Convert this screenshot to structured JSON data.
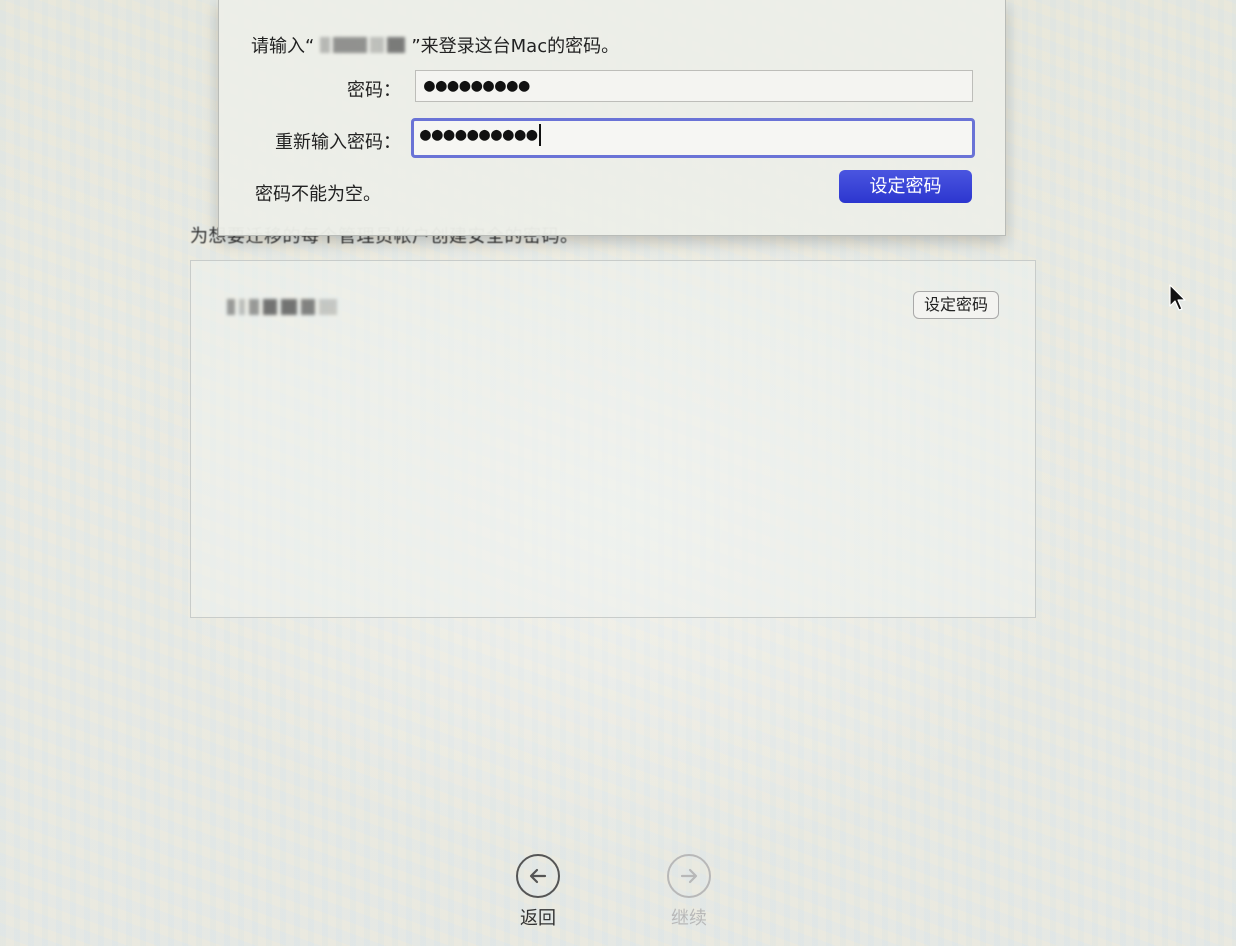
{
  "dialog": {
    "prompt_prefix": "请输入“",
    "prompt_suffix": "”来登录这台Mac的密码。",
    "password_label": "密码：",
    "password_value": "●●●●●●●●●",
    "confirm_label": "重新输入密码：",
    "confirm_value": "●●●●●●●●●●",
    "error_message": "密码不能为空。",
    "set_password_button": "设定密码"
  },
  "page": {
    "instruction": "为想要迁移的每个管理员帐户创建安全的密码。",
    "accounts": [
      {
        "name_redacted": true,
        "set_password_button": "设定密码"
      }
    ]
  },
  "navigation": {
    "back_label": "返回",
    "continue_label": "继续",
    "continue_enabled": false
  },
  "colors": {
    "accent": "#2c36cf",
    "focus_ring": "#6a73d6",
    "disabled": "#b8b8b8"
  }
}
